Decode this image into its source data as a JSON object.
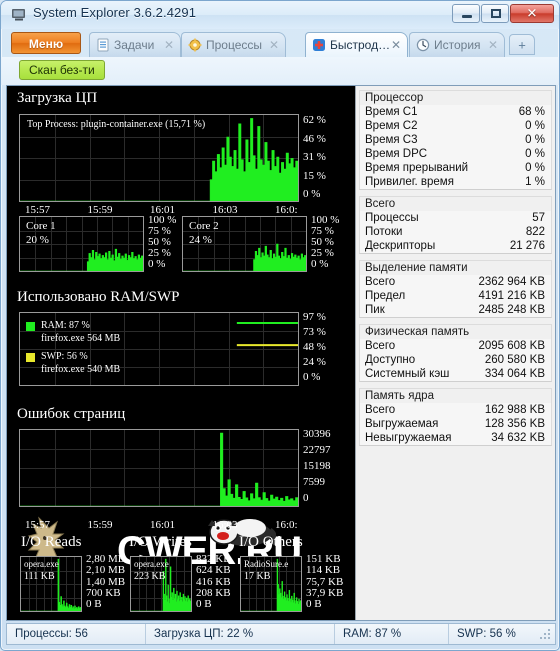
{
  "window": {
    "title": "System Explorer 3.6.2.4291",
    "icon": "app-icon",
    "minimize_label": "–",
    "maximize_label": "□",
    "close_label": "✕"
  },
  "tabstrip": {
    "menu_label": "Меню",
    "newtab_label": "+",
    "close_glyph": "✕",
    "tabs": [
      {
        "label": "Задачи",
        "icon": "tasks-icon",
        "active": false
      },
      {
        "label": "Процессы",
        "icon": "processes-icon",
        "active": false
      },
      {
        "label": "Быстрод…",
        "icon": "performance-icon",
        "active": true
      },
      {
        "label": "История",
        "icon": "history-icon",
        "active": false
      }
    ]
  },
  "toolbar": {
    "scan_label": "Скан без-ти"
  },
  "colors": {
    "graph_green": "#20ee20",
    "graph_yellow": "#e8e82c",
    "graph_bg": "#000000",
    "graph_grid": "#2b2b2b",
    "accent_orange": "#ee7f22",
    "scan_green": "#b6e84f"
  },
  "chart_data": [
    {
      "id": "cpu-usage",
      "type": "area",
      "title": "Загрузка ЦП",
      "overlay": "Top Process: plugin-container.exe (15,71 %)",
      "ylabel": "",
      "ytick_labels": [
        "62 %",
        "46 %",
        "31 %",
        "15 %",
        "0 %"
      ],
      "ylim": [
        0,
        62
      ],
      "xtick_labels": [
        "15:57",
        "15:59",
        "16:01",
        "16:03",
        "16:0:"
      ],
      "grid": true,
      "series": [
        {
          "name": "CPU",
          "color": "#20ee20",
          "values": [
            0,
            0,
            0,
            0,
            0,
            0,
            0,
            0,
            0,
            0,
            0,
            0,
            0,
            0,
            0,
            0,
            0,
            0,
            0,
            0,
            0,
            0,
            0,
            0,
            0,
            0,
            0,
            0,
            0,
            0,
            0,
            0,
            0,
            0,
            0,
            0,
            0,
            0,
            0,
            0,
            0,
            0,
            0,
            0,
            0,
            0,
            0,
            0,
            0,
            0,
            0,
            0,
            0,
            0,
            0,
            0,
            0,
            0,
            0,
            0,
            0,
            0,
            0,
            0,
            0,
            0,
            0,
            0,
            0,
            0,
            0,
            0,
            0,
            0,
            0,
            0,
            0,
            0,
            0,
            0,
            16,
            30,
            22,
            35,
            25,
            40,
            27,
            48,
            33,
            26,
            38,
            24,
            58,
            31,
            22,
            46,
            29,
            62,
            34,
            24,
            56,
            31,
            27,
            44,
            30,
            23,
            38,
            26,
            33,
            21,
            29,
            24,
            36,
            28,
            32,
            25,
            30
          ]
        }
      ]
    },
    {
      "id": "core-1",
      "type": "area",
      "title": "Core 1",
      "overlay": "20 %",
      "ytick_labels": [
        "100 %",
        "75 %",
        "50 %",
        "25 %",
        "0 %"
      ],
      "ylim": [
        0,
        100
      ],
      "grid": true,
      "series": [
        {
          "name": "Core 1",
          "color": "#20ee20",
          "values": [
            0,
            0,
            0,
            0,
            0,
            0,
            0,
            0,
            0,
            0,
            0,
            0,
            0,
            0,
            0,
            0,
            0,
            0,
            0,
            0,
            0,
            0,
            0,
            0,
            0,
            0,
            0,
            0,
            0,
            0,
            0,
            0,
            0,
            0,
            0,
            0,
            0,
            0,
            0,
            0,
            0,
            18,
            34,
            26,
            40,
            22,
            36,
            28,
            33,
            24,
            30,
            26,
            35,
            22,
            38,
            25,
            31,
            20,
            42,
            27,
            34,
            23,
            29,
            25,
            33,
            21,
            30,
            26,
            36,
            24,
            28,
            22,
            31,
            25,
            29
          ]
        }
      ]
    },
    {
      "id": "core-2",
      "type": "area",
      "title": "Core 2",
      "overlay": "24 %",
      "ytick_labels": [
        "100 %",
        "75 %",
        "50 %",
        "25 %",
        "0 %"
      ],
      "ylim": [
        0,
        100
      ],
      "grid": true,
      "series": [
        {
          "name": "Core 2",
          "color": "#20ee20",
          "values": [
            0,
            0,
            0,
            0,
            0,
            0,
            0,
            0,
            0,
            0,
            0,
            0,
            0,
            0,
            0,
            0,
            0,
            0,
            0,
            0,
            0,
            0,
            0,
            0,
            0,
            0,
            0,
            0,
            0,
            0,
            0,
            0,
            0,
            0,
            0,
            0,
            0,
            0,
            0,
            0,
            0,
            0,
            0,
            22,
            38,
            30,
            44,
            26,
            35,
            29,
            48,
            31,
            26,
            40,
            24,
            33,
            27,
            52,
            29,
            24,
            36,
            28,
            44,
            25,
            30,
            23,
            34,
            27,
            31,
            25,
            29,
            22,
            33,
            26,
            30
          ]
        }
      ]
    },
    {
      "id": "ram-swp",
      "type": "line",
      "title": "Использовано RAM/SWP",
      "ytick_labels": [
        "97 %",
        "73 %",
        "48 %",
        "24 %",
        "0 %"
      ],
      "ylim": [
        0,
        97
      ],
      "grid": true,
      "legend": [
        {
          "label": "RAM: 87 %",
          "sub": "firefox.exe 564 MB",
          "color": "#20ee20",
          "value": 87
        },
        {
          "label": "SWP: 56 %",
          "sub": "firefox.exe 540 MB",
          "color": "#e8e82c",
          "value": 56
        }
      ]
    },
    {
      "id": "page-faults",
      "type": "area",
      "title": "Ошибок страниц",
      "ytick_labels": [
        "30396",
        "22797",
        "15198",
        "7599",
        "0"
      ],
      "ylim": [
        0,
        30396
      ],
      "xtick_labels": [
        "15:57",
        "15:59",
        "16:01",
        "16:03",
        "16:0:"
      ],
      "grid": true,
      "series": [
        {
          "name": "Page Faults",
          "color": "#20ee20",
          "values": [
            0,
            0,
            0,
            0,
            0,
            0,
            0,
            0,
            0,
            0,
            0,
            0,
            0,
            0,
            0,
            0,
            0,
            0,
            0,
            0,
            0,
            0,
            0,
            0,
            0,
            0,
            0,
            0,
            0,
            0,
            0,
            0,
            0,
            0,
            0,
            0,
            0,
            0,
            0,
            0,
            0,
            0,
            0,
            0,
            0,
            0,
            0,
            0,
            0,
            0,
            0,
            0,
            0,
            0,
            0,
            0,
            0,
            0,
            0,
            0,
            0,
            0,
            0,
            0,
            0,
            0,
            0,
            0,
            0,
            0,
            0,
            0,
            0,
            0,
            0,
            0,
            0,
            0,
            0,
            0,
            26000,
            6200,
            3600,
            9400,
            4200,
            2800,
            7600,
            3100,
            2400,
            5200,
            2900,
            1900,
            4400,
            2600,
            8200,
            3000,
            2100,
            4800,
            2700,
            1800,
            3900,
            2500,
            3200,
            2000,
            2800,
            1700,
            3400,
            2200,
            2600,
            1900,
            3000
          ]
        }
      ]
    },
    {
      "id": "io-reads",
      "type": "area",
      "title": "I/O Reads",
      "overlay_proc": "opera.exe",
      "overlay_val": "111 KB",
      "ytick_labels": [
        "2,80 MB",
        "2,10 MB",
        "1,40 MB",
        "700 KB",
        "0 B"
      ],
      "grid": true,
      "series": [
        {
          "name": "I/O Reads",
          "color": "#20ee20",
          "values": [
            0,
            0,
            0,
            0,
            0,
            0,
            0,
            0,
            0,
            0,
            0,
            0,
            0,
            0,
            0,
            0,
            0,
            0,
            0,
            0,
            0,
            0,
            0,
            0,
            0,
            0,
            0,
            0,
            0,
            0,
            0,
            0,
            0,
            0,
            0,
            0,
            0,
            0,
            0,
            0,
            72,
            12,
            8,
            20,
            9,
            6,
            14,
            7,
            5,
            11,
            6,
            4,
            9,
            5,
            8,
            4,
            6,
            3,
            7,
            4,
            5,
            3,
            6,
            4,
            5
          ]
        }
      ]
    },
    {
      "id": "io-writes",
      "type": "area",
      "title": "I/O Writes",
      "overlay_proc": "opera.exe",
      "overlay_val": "223 KB",
      "ytick_labels": [
        "832 KB",
        "624 KB",
        "416 KB",
        "208 KB",
        "0 B"
      ],
      "grid": true,
      "series": [
        {
          "name": "I/O Writes",
          "color": "#20ee20",
          "values": [
            0,
            0,
            0,
            0,
            0,
            0,
            0,
            0,
            0,
            0,
            0,
            0,
            0,
            0,
            0,
            0,
            0,
            0,
            0,
            0,
            0,
            0,
            0,
            0,
            0,
            0,
            0,
            0,
            0,
            0,
            0,
            0,
            0,
            0,
            0,
            0,
            0,
            0,
            0,
            0,
            52,
            22,
            14,
            68,
            20,
            12,
            34,
            16,
            10,
            58,
            18,
            24,
            14,
            30,
            16,
            22,
            12,
            26,
            15,
            20,
            13,
            24,
            14,
            18,
            12,
            22,
            15,
            19,
            13,
            17,
            12,
            20,
            14,
            16,
            13
          ]
        }
      ]
    },
    {
      "id": "io-others",
      "type": "area",
      "title": "I/O Others",
      "overlay_proc": "RadioSure.e",
      "overlay_val": "17 KB",
      "ytick_labels": [
        "151 KB",
        "114 KB",
        "75,7 KB",
        "37,9 KB",
        "0 B"
      ],
      "grid": true,
      "series": [
        {
          "name": "I/O Others",
          "color": "#20ee20",
          "values": [
            0,
            0,
            0,
            0,
            0,
            0,
            0,
            0,
            0,
            0,
            0,
            0,
            0,
            0,
            0,
            0,
            0,
            0,
            0,
            0,
            0,
            0,
            0,
            0,
            0,
            0,
            0,
            0,
            0,
            0,
            0,
            0,
            0,
            0,
            0,
            0,
            0,
            0,
            0,
            0,
            0,
            0,
            0,
            0,
            0,
            70,
            36,
            22,
            30,
            24,
            18,
            40,
            20,
            16,
            26,
            18,
            14,
            22,
            17,
            13,
            28,
            16,
            12,
            20,
            15,
            11,
            24,
            14,
            10,
            18,
            13,
            9,
            16,
            12,
            14
          ]
        }
      ]
    }
  ],
  "sidebar": {
    "groups": [
      {
        "title": "Процессор",
        "rows": [
          {
            "label": "Время C1",
            "value": "68 %"
          },
          {
            "label": "Время C2",
            "value": "0 %"
          },
          {
            "label": "Время C3",
            "value": "0 %"
          },
          {
            "label": "Время DPC",
            "value": "0 %"
          },
          {
            "label": "Время прерываний",
            "value": "0 %"
          },
          {
            "label": "Привилег. время",
            "value": "1 %"
          }
        ]
      },
      {
        "title": "Всего",
        "rows": [
          {
            "label": "Процессы",
            "value": "57"
          },
          {
            "label": "Потоки",
            "value": "822"
          },
          {
            "label": "Дескрипторы",
            "value": "21 276"
          }
        ]
      },
      {
        "title": "Выделение памяти",
        "rows": [
          {
            "label": "Всего",
            "value": "2362 964 KB"
          },
          {
            "label": "Предел",
            "value": "4191 216 KB"
          },
          {
            "label": "Пик",
            "value": "2485 248 KB"
          }
        ]
      },
      {
        "title": "Физическая память",
        "rows": [
          {
            "label": "Всего",
            "value": "2095 608 KB"
          },
          {
            "label": "Доступно",
            "value": "260 580 KB"
          },
          {
            "label": "Системный кэш",
            "value": "334 064 KB"
          }
        ]
      },
      {
        "title": "Память ядра",
        "rows": [
          {
            "label": "Всего",
            "value": "162 988 KB"
          },
          {
            "label": "Выгружаемая",
            "value": "128 356 KB"
          },
          {
            "label": "Невыгружаемая",
            "value": "34 632 KB"
          }
        ]
      }
    ]
  },
  "statusbar": {
    "cells": [
      "Процессы: 56",
      "Загрузка ЦП: 22 %",
      "RAM: 87 %",
      "SWP: 56 %"
    ]
  },
  "watermark": {
    "text": "CWER.RU"
  }
}
